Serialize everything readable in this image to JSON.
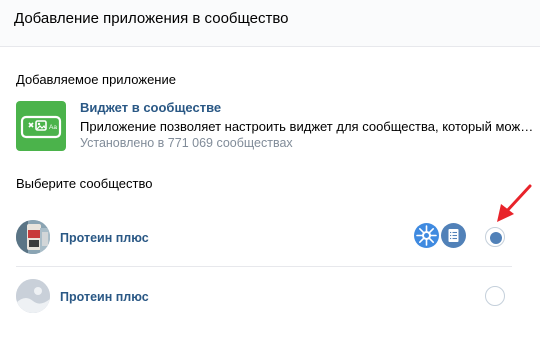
{
  "header": {
    "title": "Добавление приложения в сообщество"
  },
  "app_section": {
    "title": "Добавляемое приложение",
    "app": {
      "icon": "widget-app-icon",
      "name": "Виджет в сообществе",
      "description": "Приложение позволяет настроить виджет для сообщества, который может...",
      "installs": "Установлено в 771 069 сообществах"
    }
  },
  "community_section": {
    "title": "Выберите сообщество",
    "communities": [
      {
        "name": "Протеин плюс",
        "selected": true,
        "installed_app_icons": [
          "snowflake-app-icon",
          "checklist-app-icon"
        ]
      },
      {
        "name": "Протеин плюс",
        "selected": false,
        "installed_app_icons": []
      }
    ]
  },
  "colors": {
    "link": "#2a5885",
    "app_green": "#4bb34b",
    "radio_selected": "#5181b8",
    "muted": "#818c99",
    "annotation_arrow": "#e8232a"
  }
}
